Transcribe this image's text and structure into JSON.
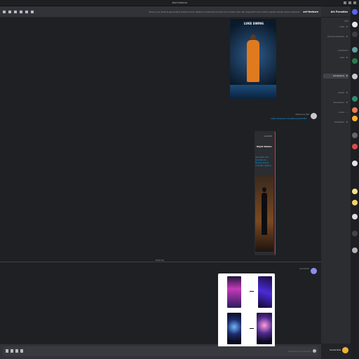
{
  "window": {
    "title": "#art-feature"
  },
  "server": {
    "name": "Art Paradise"
  },
  "user": {
    "name": "leonardoai"
  },
  "sidebar": {
    "categories": [
      "INFO",
      "COMMUNITY"
    ],
    "channels": [
      {
        "label": "rules"
      },
      {
        "label": "announcements"
      },
      {
        "label": "chat"
      },
      {
        "label": "art-feature"
      },
      {
        "label": "share"
      },
      {
        "label": "discussion"
      },
      {
        "label": "voice"
      },
      {
        "label": "feedback"
      }
    ]
  },
  "header": {
    "channel": "art-feature",
    "topic": "Share your best AI-generated artwork here. Please include the prompt and model used. Be respectful and credit original artists where relevant."
  },
  "messages": [
    {
      "image_caption": "LUKE SWING",
      "author": "Midjourney Bot",
      "link": "https://example.com/gallery/post/2483"
    },
    {
      "embed_site": "Leonardo",
      "embed_title": "Night Walker",
      "embed_desc": "Generated with Leonardo AI — Phoenix model, cinematic lighting"
    }
  ],
  "divider": {
    "label": "Yesterday"
  },
  "attachment_author": "leonardoai",
  "composer": {
    "placeholder": "Message #art-feature"
  },
  "colors": {
    "accent": "#5865f2",
    "link": "#00a8fc",
    "embed_bar": "#da373c"
  }
}
